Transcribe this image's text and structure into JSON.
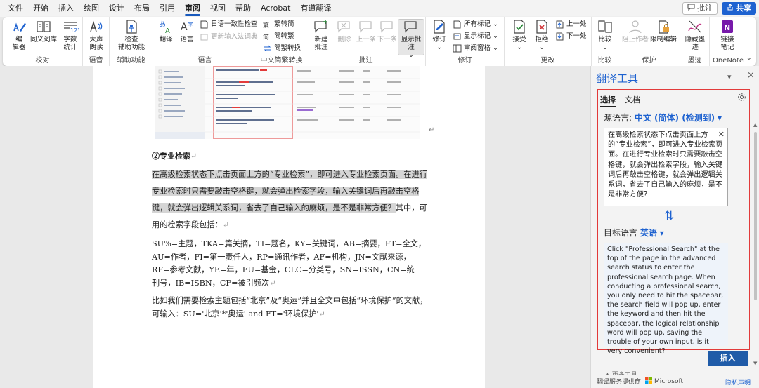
{
  "menubar": {
    "items": [
      "文件",
      "开始",
      "插入",
      "绘图",
      "设计",
      "布局",
      "引用",
      "审阅",
      "视图",
      "帮助",
      "Acrobat",
      "有道翻译"
    ],
    "active_index": 7,
    "comment_label": "批注",
    "share_label": "共享"
  },
  "ribbon": {
    "groups": {
      "proofing": "校对",
      "speech": "语音",
      "accessibility": "辅助功能",
      "language": "语言",
      "chinese_convert": "中文简繁转换",
      "comments": "批注",
      "tracking": "修订",
      "changes": "更改",
      "compare": "比较",
      "protect": "保护",
      "ink": "墨迹",
      "onenote": "OneNote"
    },
    "buttons": {
      "editor": [
        "编",
        "辑器"
      ],
      "thesaurus": "同义词库",
      "word_count": [
        "字数",
        "统计"
      ],
      "read_aloud": [
        "大声",
        "朗读"
      ],
      "check_access": [
        "检查",
        "辅助功能"
      ],
      "translate": "翻译",
      "language": "语言",
      "consistency": "日语一致性检查",
      "ime_dict": "更新输入法词典",
      "to_trad": "繁转简",
      "to_simp": "简转繁",
      "convert": "简繁转换",
      "new_comment": [
        "新建",
        "批注"
      ],
      "delete": "删除",
      "prev": "上一条",
      "next": "下一条",
      "show_comments": "显示批注",
      "track": "修订",
      "all_markup": "所有标记",
      "show_markup": "显示标记",
      "review_pane": "审阅窗格",
      "accept": "接受",
      "reject": "拒绝",
      "prev_change": "上一处",
      "next_change": "下一处",
      "compare": "比较",
      "block_authors": "阻止作者",
      "restrict": "限制编辑",
      "hide_ink": [
        "隐藏墨",
        "迹"
      ],
      "linked_notes": [
        "链接",
        "笔记"
      ]
    }
  },
  "document": {
    "heading": "②专业检索",
    "para1_selected": "在高级检索状态下点击页面上方的“专业检索”，即可进入专业检索页面。在进行专业检索时只需要敲击空格键，就会弹出检索字段，输入关键词后再敲击空格键，就会弹出逻辑关系词，省去了自己输入的麻烦，是不是非常方便？",
    "para1_rest": "其中，可用的检索字段包括：",
    "para2": "SU%=主题，TKA=篇关摘，TI=题名，KY=关键词，AB=摘要，FT=全文，AU=作者，FI=第一责任人，RP=通讯作者，AF=机构，JN=文献来源，RF=参考文献，YE=年，FU=基金，CLC=分类号，SN=ISSN，CN=统一刊号，IB=ISBN，CF=被引频次",
    "para3": "比如我们需要检索主题包括“北京”及“奥运”并且全文中包括“环境保护”的文献，可输入：SU='北京'*'奥运' and FT='环境保护'"
  },
  "translate_pane": {
    "title": "翻译工具",
    "tab_selection": "选择",
    "tab_document": "文档",
    "source_label": "源语言:",
    "source_lang": "中文 (简体) (检测到)",
    "source_text": "在高级检索状态下点击页面上方的“专业检索”，即可进入专业检索页面。在进行专业检索时只需要敲击空格键，就会弹出检索字段，输入关键词后再敲击空格键，就会弹出逻辑关系词，省去了自己输入的麻烦，是不是非常方便?",
    "target_label": "目标语言",
    "target_lang": "英语",
    "target_text": "Click \"Professional Search\" at the top of the page in the advanced search status to enter the professional search page. When conducting a professional search, you only need to hit the spacebar, the search field will pop up, enter the keyword and then hit the spacebar, the logical relationship word will pop up, saving the trouble of your own input, is it very convenient?",
    "insert_label": "插入",
    "provider_label": "翻译服务提供商:",
    "provider_name": "Microsoft",
    "privacy_label": "隐私声明",
    "hidden_section": "▲ 更多工具"
  },
  "colors": {
    "accent": "#1e62d0",
    "highlight_box": "#e23a3a",
    "insert_button": "#1f5ba8"
  }
}
